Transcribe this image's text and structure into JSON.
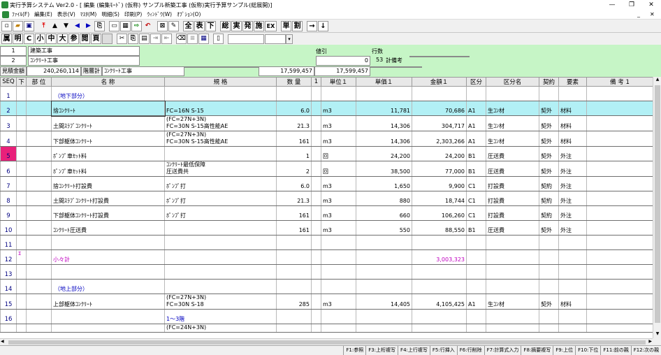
{
  "titlebar": {
    "title": "実行予算システム Ver2.0 - [ 編集 (編集ﾓｰﾄﾞ) (仮称) サンプル新築工事 (仮称)実行予算サンプル(総展開)]",
    "minimize": "—",
    "maximize": "❐",
    "close": "✕"
  },
  "menu": [
    "ﾌｧｲﾙ(F)",
    "編集(E)",
    "表示(V)",
    "ﾏｽﾀ(M)",
    "明細(S)",
    "印刷(P)",
    "ｳｨﾝﾄﾞｳ(W)",
    "ｵﾌﾟｼｮﾝ(O)"
  ],
  "mdi": {
    "minimize": "_",
    "close": "✕"
  },
  "toolbar1": {
    "b1": "全",
    "b2": "表",
    "b3": "下",
    "b4": "総",
    "b5": "実",
    "b6": "発",
    "b7": "施",
    "b8": "EX",
    "b9": "単",
    "b10": "割",
    "b11": "→",
    "b12": "↓"
  },
  "toolbar2": {
    "b1": "属",
    "b2": "明",
    "b3": "C",
    "b4": "小",
    "b5": "中",
    "b6": "大",
    "b7": "参",
    "b8": "閲",
    "b9": "頁"
  },
  "header": {
    "level1_no": "1",
    "level1_name": "建築工事",
    "level2_no": "2",
    "level2_name": "ｺﾝｸﾘｰﾄ工事",
    "discount_label": "値引",
    "discount_value": "0",
    "rows_label": "行数",
    "rows_value": "53",
    "calc_note": "計備考",
    "estimate_label": "見積金額",
    "estimate_value": "240,260,114",
    "floor_label": "階層計",
    "floor_name": "ｺﾝｸﾘｰﾄ工事",
    "floor_total1": "17,599,457",
    "floor_total2": "17,599,457"
  },
  "columns": {
    "seq": "SEQ",
    "ka": "下",
    "bui": "部 位",
    "name": "名 称",
    "spec": "規 格",
    "qty": "数 量",
    "q1": "1",
    "unit": "単位１",
    "price": "単価１",
    "amount": "金額１",
    "kubun": "区分",
    "kubun_name": "区分名",
    "contract": "契約",
    "element": "要素",
    "note": "備 考 1"
  },
  "rows": [
    {
      "seq": "1",
      "name": "（地下部分）",
      "spec1": "",
      "spec2": "",
      "qty": "",
      "unit": "",
      "price": "",
      "amount": "",
      "kubun": "",
      "kname": "",
      "contract": "",
      "element": "",
      "style": "blue"
    },
    {
      "seq": "2",
      "name": "捨ｺﾝｸﾘｰﾄ",
      "spec1": "",
      "spec2": "FC=16N S-15",
      "qty": "6.0",
      "unit": "m3",
      "price": "11,781",
      "amount": "70,686",
      "kubun": "A1",
      "kname": "生ｺﾝ材",
      "contract": "契外",
      "element": "材料",
      "style": "sel"
    },
    {
      "seq": "3",
      "name": "土間ｽﾗﾌﾞｺﾝｸﾘｰﾄ",
      "spec1": "(FC=27N+3N)",
      "spec2": "FC=30N S-15高性能AE",
      "qty": "21.3",
      "unit": "m3",
      "price": "14,306",
      "amount": "304,717",
      "kubun": "A1",
      "kname": "生ｺﾝ材",
      "contract": "契外",
      "element": "材料",
      "style": ""
    },
    {
      "seq": "4",
      "name": "下部躯体ｺﾝｸﾘｰﾄ",
      "spec1": "(FC=27N+3N)",
      "spec2": "FC=30N S-15高性能AE",
      "qty": "161",
      "unit": "m3",
      "price": "14,306",
      "amount": "2,303,266",
      "kubun": "A1",
      "kname": "生ｺﾝ材",
      "contract": "契外",
      "element": "材料",
      "style": ""
    },
    {
      "seq": "5",
      "name": "ﾎﾟﾝﾌﾟ車ｾｯﾄ料",
      "spec1": "",
      "spec2": "",
      "qty": "1",
      "unit": "回",
      "price": "24,200",
      "amount": "24,200",
      "kubun": "B1",
      "kname": "圧送費",
      "contract": "契外",
      "element": "外注",
      "style": "pink"
    },
    {
      "seq": "6",
      "name": "ﾎﾟﾝﾌﾟ車ｾｯﾄ料",
      "spec1": "ｺﾝｸﾘｰﾄ最低保障",
      "spec2": "圧送費共",
      "qty": "2",
      "unit": "回",
      "price": "38,500",
      "amount": "77,000",
      "kubun": "B1",
      "kname": "圧送費",
      "contract": "契外",
      "element": "外注",
      "style": ""
    },
    {
      "seq": "7",
      "name": "捨ｺﾝｸﾘｰﾄ打設費",
      "spec1": "",
      "spec2": "ﾎﾟﾝﾌﾟ打",
      "qty": "6.0",
      "unit": "m3",
      "price": "1,650",
      "amount": "9,900",
      "kubun": "C1",
      "kname": "打設費",
      "contract": "契約",
      "element": "外注",
      "style": ""
    },
    {
      "seq": "8",
      "name": "土間ｽﾗﾌﾞｺﾝｸﾘｰﾄ打設費",
      "spec1": "",
      "spec2": "ﾎﾟﾝﾌﾟ打",
      "qty": "21.3",
      "unit": "m3",
      "price": "880",
      "amount": "18,744",
      "kubun": "C1",
      "kname": "打設費",
      "contract": "契約",
      "element": "外注",
      "style": ""
    },
    {
      "seq": "9",
      "name": "下部躯体ｺﾝｸﾘｰﾄ打設費",
      "spec1": "",
      "spec2": "ﾎﾟﾝﾌﾟ打",
      "qty": "161",
      "unit": "m3",
      "price": "660",
      "amount": "106,260",
      "kubun": "C1",
      "kname": "打設費",
      "contract": "契約",
      "element": "外注",
      "style": ""
    },
    {
      "seq": "10",
      "name": "ｺﾝｸﾘｰﾄ圧送費",
      "spec1": "",
      "spec2": "",
      "qty": "161",
      "unit": "m3",
      "price": "550",
      "amount": "88,550",
      "kubun": "B1",
      "kname": "圧送費",
      "contract": "契外",
      "element": "外注",
      "style": ""
    },
    {
      "seq": "11",
      "name": "",
      "spec1": "",
      "spec2": "",
      "qty": "",
      "unit": "",
      "price": "",
      "amount": "",
      "kubun": "",
      "kname": "",
      "contract": "",
      "element": "",
      "style": ""
    },
    {
      "seq": "12",
      "ka": "Σ",
      "name": "小々計",
      "spec1": "",
      "spec2": "",
      "qty": "",
      "unit": "",
      "price": "",
      "amount": "3,003,323",
      "kubun": "",
      "kname": "",
      "contract": "",
      "element": "",
      "style": "mag"
    },
    {
      "seq": "13",
      "name": "",
      "spec1": "",
      "spec2": "",
      "qty": "",
      "unit": "",
      "price": "",
      "amount": "",
      "kubun": "",
      "kname": "",
      "contract": "",
      "element": "",
      "style": ""
    },
    {
      "seq": "14",
      "name": "（地上部分）",
      "spec1": "",
      "spec2": "",
      "qty": "",
      "unit": "",
      "price": "",
      "amount": "",
      "kubun": "",
      "kname": "",
      "contract": "",
      "element": "",
      "style": "blue"
    },
    {
      "seq": "15",
      "name": "上部躯体ｺﾝｸﾘｰﾄ",
      "spec1": "(FC=27N+3N)",
      "spec2": "FC=30N S-18",
      "qty": "285",
      "unit": "m3",
      "price": "14,405",
      "amount": "4,105,425",
      "kubun": "A1",
      "kname": "生ｺﾝ材",
      "contract": "契外",
      "element": "材料",
      "style": ""
    },
    {
      "seq": "16",
      "name": "",
      "spec1": "",
      "spec2": "1～3階",
      "qty": "",
      "unit": "",
      "price": "",
      "amount": "",
      "kubun": "",
      "kname": "",
      "contract": "",
      "element": "",
      "style": "spec-blue"
    },
    {
      "seq": "",
      "name": "",
      "spec1": "(FC=24N+3N)",
      "spec2": "",
      "qty": "",
      "unit": "",
      "price": "",
      "amount": "",
      "kubun": "",
      "kname": "",
      "contract": "",
      "element": "",
      "style": "partial"
    }
  ],
  "statusbar": [
    "F1:参照",
    "F3:上桁複写",
    "F4:上行複写",
    "F5:行挿入",
    "F6:行削除",
    "F7:計算式入力",
    "F8:摘要複写",
    "F9:上位",
    "F10:下位",
    "F11:前の親",
    "F12:次の親"
  ]
}
